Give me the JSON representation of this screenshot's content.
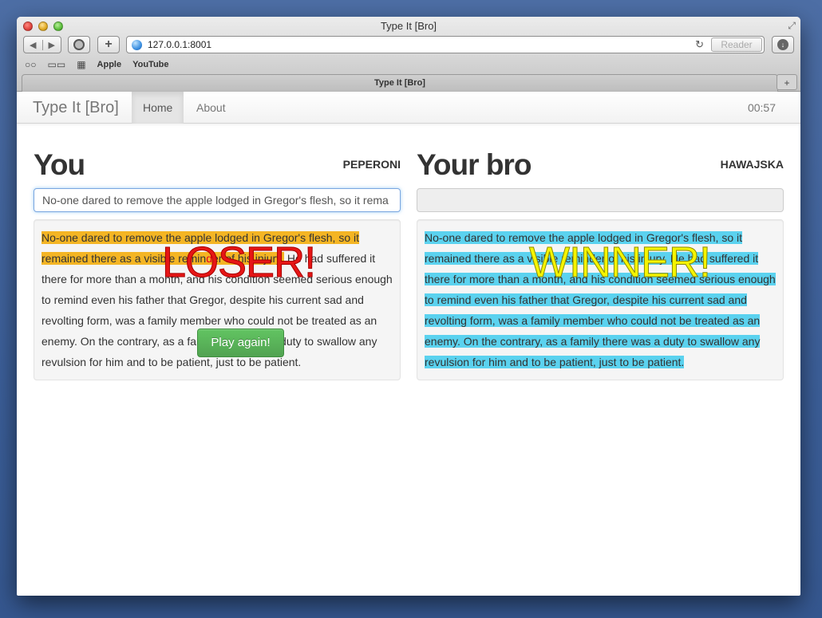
{
  "window": {
    "title": "Type It [Bro]"
  },
  "browser": {
    "url": "127.0.0.1:8001",
    "reader_label": "Reader",
    "bookmarks": [
      "Apple",
      "YouTube"
    ],
    "tab_title": "Type It [Bro]"
  },
  "navbar": {
    "brand": "Type It [Bro]",
    "links": [
      "Home",
      "About"
    ],
    "active": "Home",
    "timer": "00:57"
  },
  "players": {
    "you": {
      "heading": "You",
      "pizza": "PEPERONI",
      "input_value": "No-one dared to remove the apple lodged in Gregor's flesh, so it rema",
      "result": "LOSER!",
      "typed_part_1": "No-one dared to remove the apple lodged in Gregor's flesh, so it remained there as a visible remin",
      "error_char": "d",
      "typed_part_2": "er of his injury.",
      "remaining_text": " He had suffered it there for more than a month, and his condition seemed serious enough to remind even his father that Gregor, despite his current sad and revolting form, was a family member who could not be treated as an enemy. On the contrary, as a family there was a duty to swallow any revulsion for him and to be patient, just to be patient.",
      "play_again": "Play again!"
    },
    "bro": {
      "heading": "Your bro",
      "pizza": "HAWAJSKA",
      "input_value": "",
      "result": "WINNER!",
      "typed_text": "No-one dared to remove the apple lodged in Gregor's flesh, so it remained there as a visible reminder of his injury. He had suffered it there for more than a month, and his condition seemed serious enough to remind even his father that Gregor, despite his current sad and revolting form, was a family member who could not be treated as an enemy. On the contrary, as a family there was a duty to swallow any revulsion for him and to be patient, just to be patient."
    }
  },
  "colors": {
    "loser_highlight": "#f4b524",
    "winner_highlight": "#5bd2ef",
    "loser_text": "#e61616",
    "winner_text": "#f5f500",
    "play_button": "#5bb75b"
  },
  "icons": [
    "back-icon",
    "forward-icon",
    "share-icon",
    "add-bookmark-icon",
    "globe-icon",
    "reload-icon",
    "download-icon",
    "reading-list-icon",
    "bookmarks-book-icon",
    "top-sites-grid-icon",
    "new-tab-icon",
    "fullscreen-icon"
  ]
}
